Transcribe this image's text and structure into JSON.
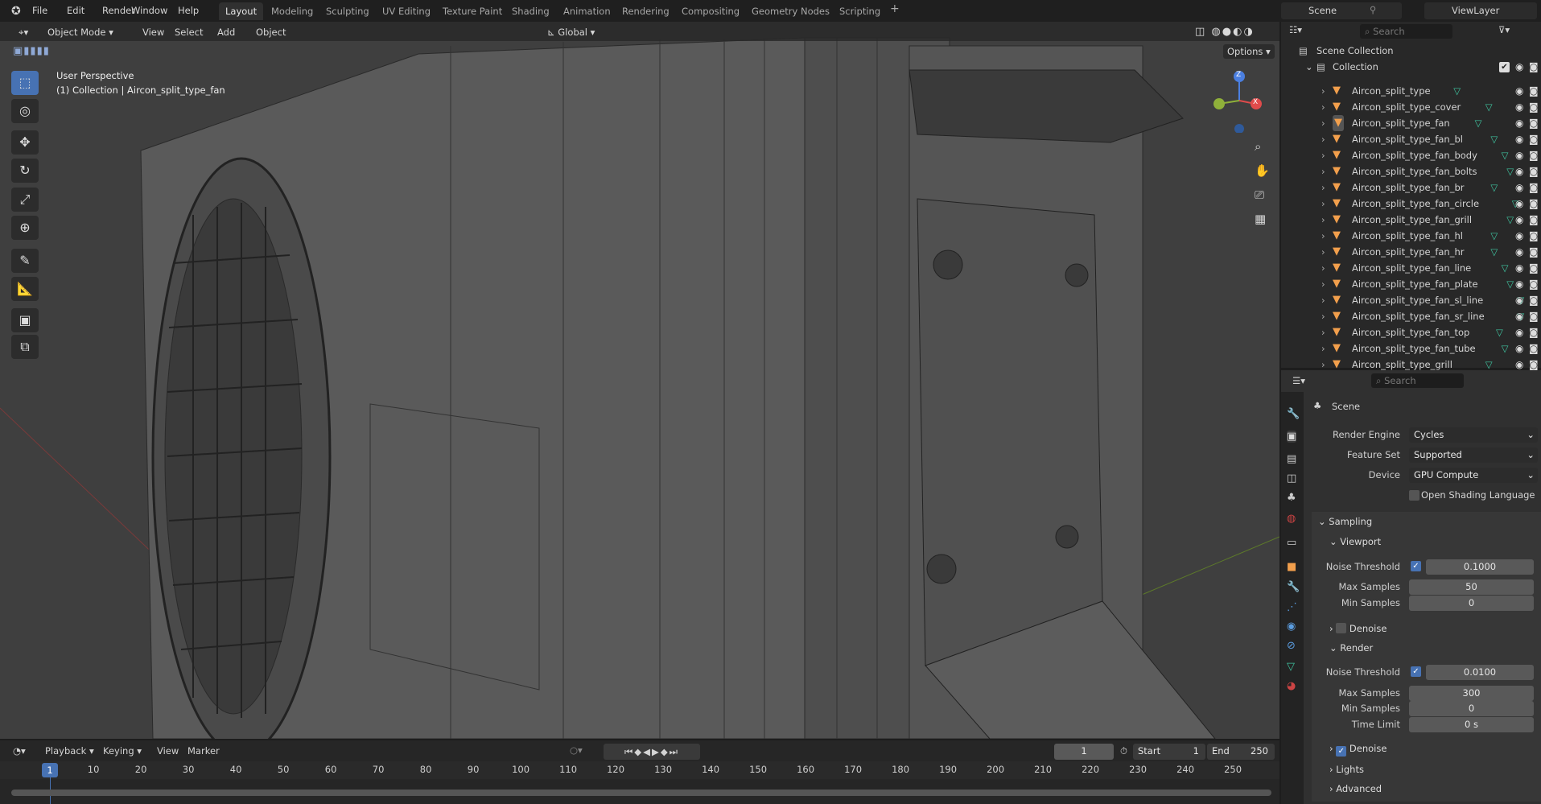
{
  "menu": [
    "File",
    "Edit",
    "Render",
    "Window",
    "Help"
  ],
  "workspaces": [
    "Layout",
    "Modeling",
    "Sculpting",
    "UV Editing",
    "Texture Paint",
    "Shading",
    "Animation",
    "Rendering",
    "Compositing",
    "Geometry Nodes",
    "Scripting"
  ],
  "scene_name": "Scene",
  "view_layer": "ViewLayer",
  "viewport": {
    "mode": "Object Mode",
    "menus": [
      "View",
      "Select",
      "Add",
      "Object"
    ],
    "orientation": "Global",
    "options": "Options",
    "overlay_title": "User Perspective",
    "overlay_sub": "(1) Collection | Aircon_split_type_fan",
    "gizmo": {
      "z": "Z",
      "x": "X"
    }
  },
  "tools": [
    "select-box",
    "cursor",
    "move",
    "rotate",
    "scale",
    "transform",
    "annotate",
    "measure",
    "add-cube",
    "extrude"
  ],
  "outliner": {
    "search_placeholder": "Search",
    "scene_collection": "Scene Collection",
    "collection": "Collection",
    "items": [
      "Aircon_split_type",
      "Aircon_split_type_cover",
      "Aircon_split_type_fan",
      "Aircon_split_type_fan_bl",
      "Aircon_split_type_fan_body",
      "Aircon_split_type_fan_bolts",
      "Aircon_split_type_fan_br",
      "Aircon_split_type_fan_circle",
      "Aircon_split_type_fan_grill",
      "Aircon_split_type_fan_hl",
      "Aircon_split_type_fan_hr",
      "Aircon_split_type_fan_line",
      "Aircon_split_type_fan_plate",
      "Aircon_split_type_fan_sl_line",
      "Aircon_split_type_fan_sr_line",
      "Aircon_split_type_fan_top",
      "Aircon_split_type_fan_tube",
      "Aircon_split_type_grill"
    ],
    "active_item": "Aircon_split_type_fan"
  },
  "properties": {
    "search_placeholder": "Search",
    "context": "Scene",
    "render_engine_label": "Render Engine",
    "render_engine": "Cycles",
    "feature_set_label": "Feature Set",
    "feature_set": "Supported",
    "device_label": "Device",
    "device": "GPU Compute",
    "osl_label": "Open Shading Language",
    "sampling": "Sampling",
    "viewport": "Viewport",
    "render": "Render",
    "noise_label": "Noise Threshold",
    "max_label": "Max Samples",
    "min_label": "Min Samples",
    "time_label": "Time Limit",
    "denoise_label": "Denoise",
    "vp_noise": "0.1000",
    "vp_max": "50",
    "vp_min": "0",
    "r_noise": "0.0100",
    "r_max": "300",
    "r_min": "0",
    "r_time": "0 s",
    "lights": "Lights",
    "advanced": "Advanced"
  },
  "timeline": {
    "menus": [
      "Playback",
      "Keying",
      "View",
      "Marker"
    ],
    "current_frame": "1",
    "start_label": "Start",
    "start": "1",
    "end_label": "End",
    "end": "250",
    "ticks": [
      "10",
      "20",
      "30",
      "40",
      "50",
      "60",
      "70",
      "80",
      "90",
      "100",
      "110",
      "120",
      "130",
      "140",
      "150",
      "160",
      "170",
      "180",
      "190",
      "200",
      "210",
      "220",
      "230",
      "240",
      "250"
    ]
  },
  "colors": {
    "accent": "#4772b3",
    "mesh": "#f29f4c",
    "data": "#3fc4a0"
  }
}
